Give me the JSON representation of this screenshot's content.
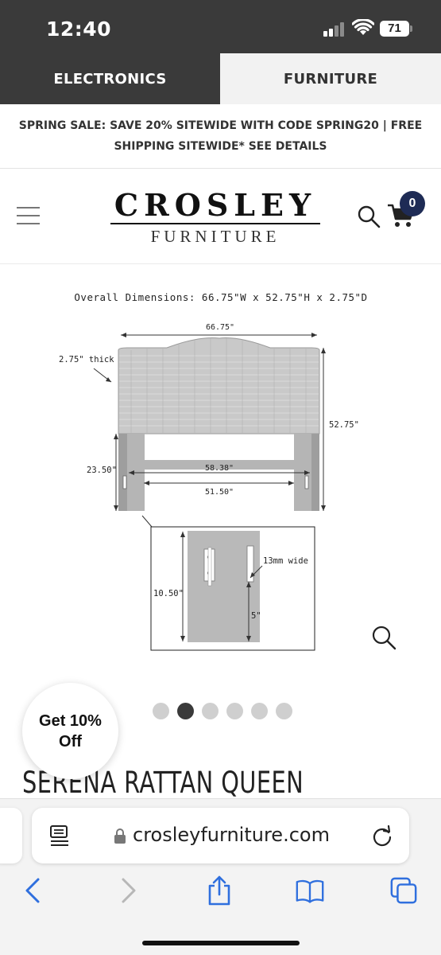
{
  "status_bar": {
    "time": "12:40",
    "battery": "71"
  },
  "top_tabs": [
    {
      "label": "ELECTRONICS"
    },
    {
      "label": "FURNITURE"
    }
  ],
  "promo": {
    "text": "SPRING SALE: SAVE 20% SITEWIDE WITH CODE SPRING20 | FREE SHIPPING SITEWIDE* SEE DETAILS"
  },
  "header": {
    "logo_main": "CROSLEY",
    "logo_sub": "FURNITURE",
    "cart_count": "0"
  },
  "diagram": {
    "overall": "Overall Dimensions: 66.75\"W x 52.75\"H x 2.75\"D",
    "width_label": "66.75\"",
    "thick_label": "2.75\" thick",
    "height_label": "52.75\"",
    "leg_label": "23.50\"",
    "inner_label": "58.38\"",
    "base_label": "51.50\"",
    "detail_height": "10.50\"",
    "slot_label": "13mm wide",
    "slot_depth": "5\""
  },
  "carousel": {
    "total": 6,
    "active_index": 1
  },
  "discount": {
    "line1": "Get 10%",
    "line2": "Off"
  },
  "product": {
    "title": "SERENA RATTAN QUEEN"
  },
  "browser": {
    "url": "crosleyfurniture.com"
  },
  "colors": {
    "dark": "#3a3a3a",
    "badge": "#1e2b55",
    "light_tab": "#f2f2f2"
  }
}
